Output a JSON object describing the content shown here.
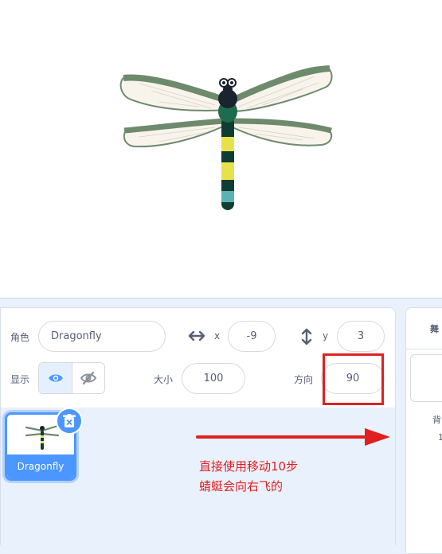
{
  "sprite_info": {
    "sprite_label": "角色",
    "sprite_name": "Dragonfly",
    "x_label": "x",
    "x_value": "-9",
    "y_label": "y",
    "y_value": "3",
    "show_label": "显示",
    "size_label": "大小",
    "size_value": "100",
    "direction_label": "方向",
    "direction_value": "90"
  },
  "sprite_list": {
    "items": [
      {
        "name": "Dragonfly",
        "selected": true
      }
    ]
  },
  "stage_panel": {
    "title": "舞",
    "backdrop_label": "背",
    "backdrop_count": "1"
  },
  "annotation": {
    "line1": "直接使用移动10步",
    "line2": "蜻蜓会向右飞的",
    "color": "#e02020"
  },
  "colors": {
    "accent": "#4c97ff",
    "panel_bg": "#e9f1fc"
  }
}
